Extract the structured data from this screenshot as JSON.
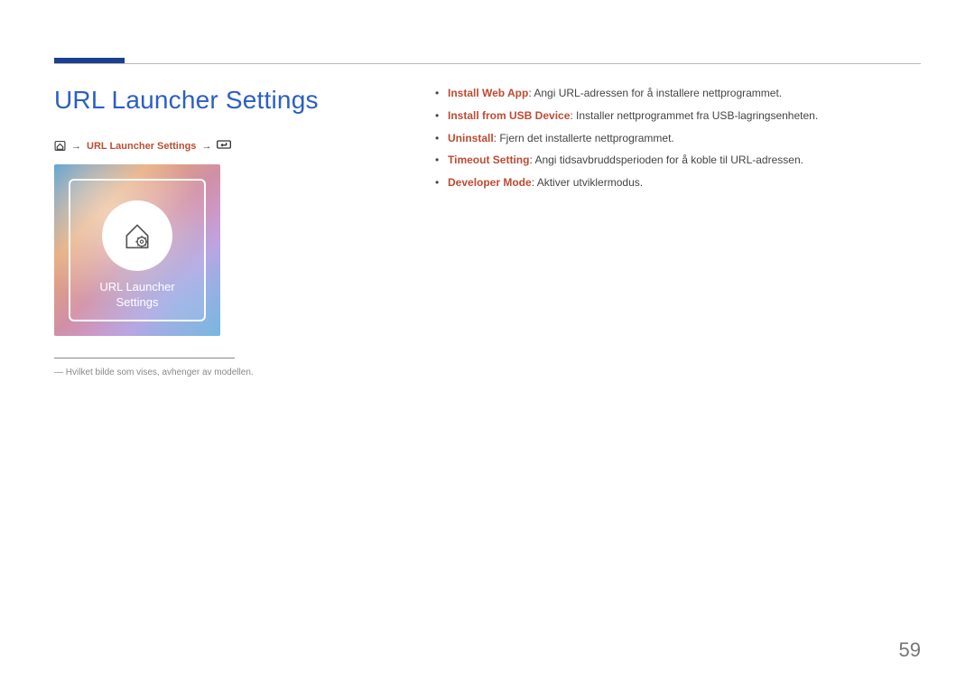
{
  "section_title": "URL Launcher Settings",
  "nav": {
    "label": "URL Launcher Settings"
  },
  "thumbnail": {
    "card_label": "URL Launcher\nSettings"
  },
  "footnote": "―  Hvilket bilde som vises, avhenger av modellen.",
  "features": [
    {
      "term": "Install Web App",
      "desc": ": Angi URL-adressen for å installere nettprogrammet."
    },
    {
      "term": "Install from USB Device",
      "desc": ": Installer nettprogrammet fra USB-lagringsenheten."
    },
    {
      "term": "Uninstall",
      "desc": ": Fjern det installerte nettprogrammet."
    },
    {
      "term": "Timeout Setting",
      "desc": ": Angi tidsavbruddsperioden for å koble til URL-adressen."
    },
    {
      "term": "Developer Mode",
      "desc": ": Aktiver utviklermodus."
    }
  ],
  "page_number": "59"
}
